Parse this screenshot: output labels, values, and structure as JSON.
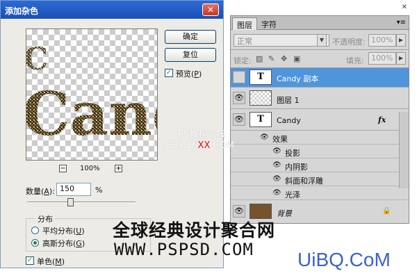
{
  "dialog": {
    "title": "添加杂色",
    "close_glyph": "✕",
    "ok_label": "确定",
    "reset_label": "复位",
    "preview_checkbox": {
      "label_prefix": "预览(",
      "label_key": "P",
      "label_suffix": ")",
      "checked": true
    },
    "zoom": {
      "minus": "−",
      "plus": "+",
      "value": "100%"
    },
    "amount": {
      "label_prefix": "数量(",
      "label_key": "A",
      "label_suffix": "):",
      "value": "150",
      "unit": "%",
      "slider_fraction": 0.4
    },
    "distribution": {
      "title": "分布",
      "uniform": {
        "label_prefix": "平均分布(",
        "label_key": "U",
        "label_suffix": ")",
        "selected": false
      },
      "gaussian": {
        "label_prefix": "高斯分布(",
        "label_key": "G",
        "label_suffix": ")",
        "selected": true
      }
    },
    "monochromatic": {
      "label_prefix": "单色(",
      "label_key": "M",
      "label_suffix": ")",
      "checked": true
    },
    "preview_text": "Cand"
  },
  "layers_panel": {
    "tabs": [
      "图层",
      "字符"
    ],
    "menu_glyph": "▾≡",
    "close_glyph": "✕",
    "blend_mode": "正常",
    "opacity_label": "不透明度:",
    "opacity_value": "100%",
    "lock_label": "锁定:",
    "fill_label": "填充:",
    "fill_value": "100%",
    "eye_glyph": "👁",
    "layers": [
      {
        "name": "Candy 副本",
        "thumb": "T",
        "visible": false,
        "selected": true
      },
      {
        "name": "图层 1",
        "thumb": "checker",
        "visible": true,
        "selected": false
      },
      {
        "name": "Candy",
        "thumb": "T",
        "visible": true,
        "selected": false,
        "fx": "fx"
      },
      {
        "name": "背景",
        "thumb": "brown",
        "visible": true,
        "selected": false,
        "locked": true
      }
    ],
    "effects_title": "效果",
    "effects": [
      "投影",
      "内阴影",
      "斜面和浮雕",
      "光泽"
    ],
    "lock_glyph": "🔒"
  },
  "watermarks": {
    "line1": "PS教程论坛",
    "line2_prefix": "BBS.16",
    "line2_red": "XX",
    "line2_suffix": ".COM",
    "big_cn": "全球经典设计聚合网",
    "big_url": "WWW.PSPSD.COM",
    "uibq": "UiBQ.CoM"
  },
  "colors": {
    "title_bar": "#1a4fb4",
    "selection": "#4f95db",
    "background_thumb": "#76532b",
    "uibq": "#3a62d0"
  }
}
